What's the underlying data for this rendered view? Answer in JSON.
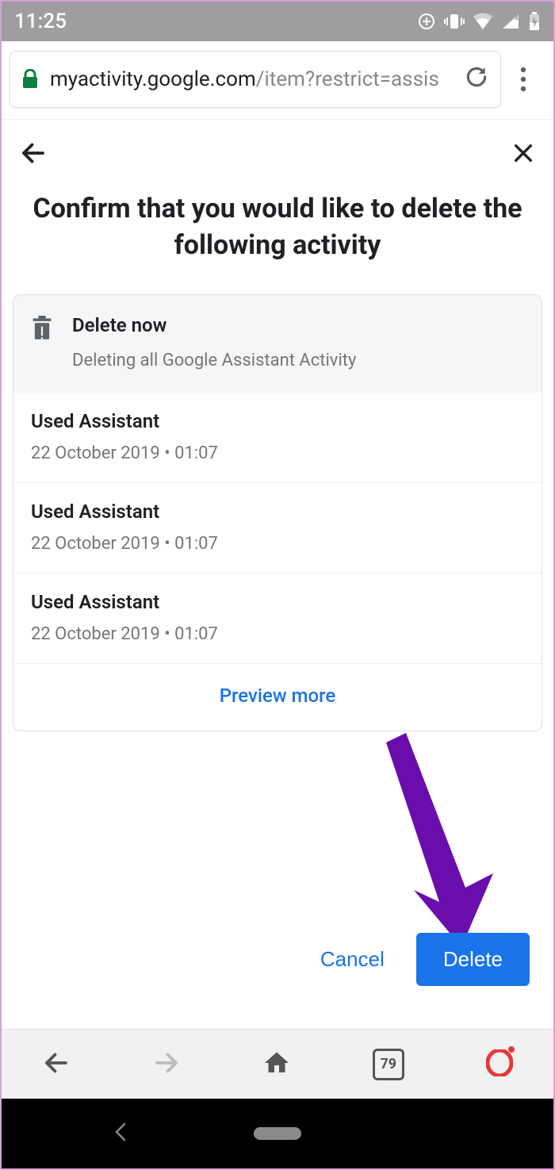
{
  "status": {
    "time": "11:25"
  },
  "address": {
    "domain": "myactivity.google.com",
    "path": "/item?restrict=assis"
  },
  "page": {
    "title": "Confirm that you would like to delete the following activity"
  },
  "card": {
    "header": {
      "title": "Delete now",
      "subtitle": "Deleting all Google Assistant Activity"
    },
    "items": [
      {
        "title": "Used Assistant",
        "date": "22 October 2019 • 01:07"
      },
      {
        "title": "Used Assistant",
        "date": "22 October 2019 • 01:07"
      },
      {
        "title": "Used Assistant",
        "date": "22 October 2019 • 01:07"
      }
    ],
    "preview_label": "Preview more"
  },
  "actions": {
    "cancel": "Cancel",
    "delete": "Delete"
  },
  "browser_nav": {
    "tabcount": "79"
  }
}
